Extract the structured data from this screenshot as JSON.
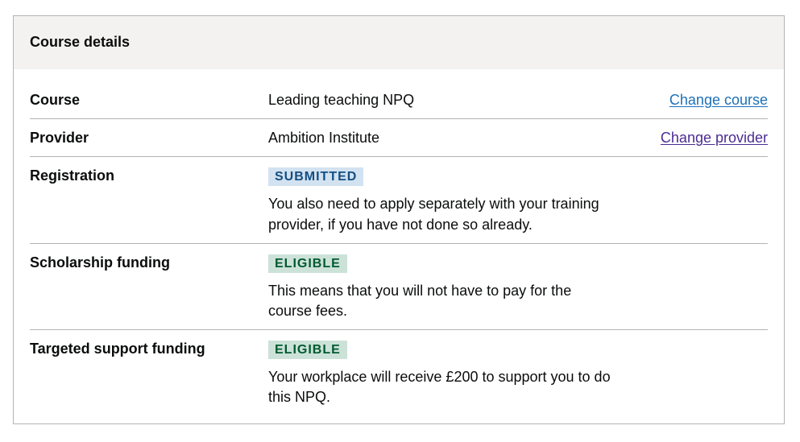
{
  "card": {
    "title": "Course details"
  },
  "rows": [
    {
      "key": "Course",
      "value": "Leading teaching NPQ",
      "action": "Change course"
    },
    {
      "key": "Provider",
      "value": "Ambition Institute",
      "action": "Change provider"
    },
    {
      "key": "Registration",
      "tag": "SUBMITTED",
      "tag_color": "#d2e2f1",
      "description": "You also need to apply separately with your training provider, if you have not done so already."
    },
    {
      "key": "Scholarship funding",
      "tag": "ELIGIBLE",
      "tag_color": "#cce2d8",
      "description": "This means that you will not have to pay for the course fees."
    },
    {
      "key": "Targeted support funding",
      "tag": "ELIGIBLE",
      "tag_color": "#cce2d8",
      "description": "Your workplace will receive £200 to support you to do this NPQ."
    }
  ],
  "colors": {
    "link": "#1d70b8",
    "link_visited": "#4c2c92",
    "header_bg": "#f3f2f1",
    "border": "#b1b4b6"
  }
}
